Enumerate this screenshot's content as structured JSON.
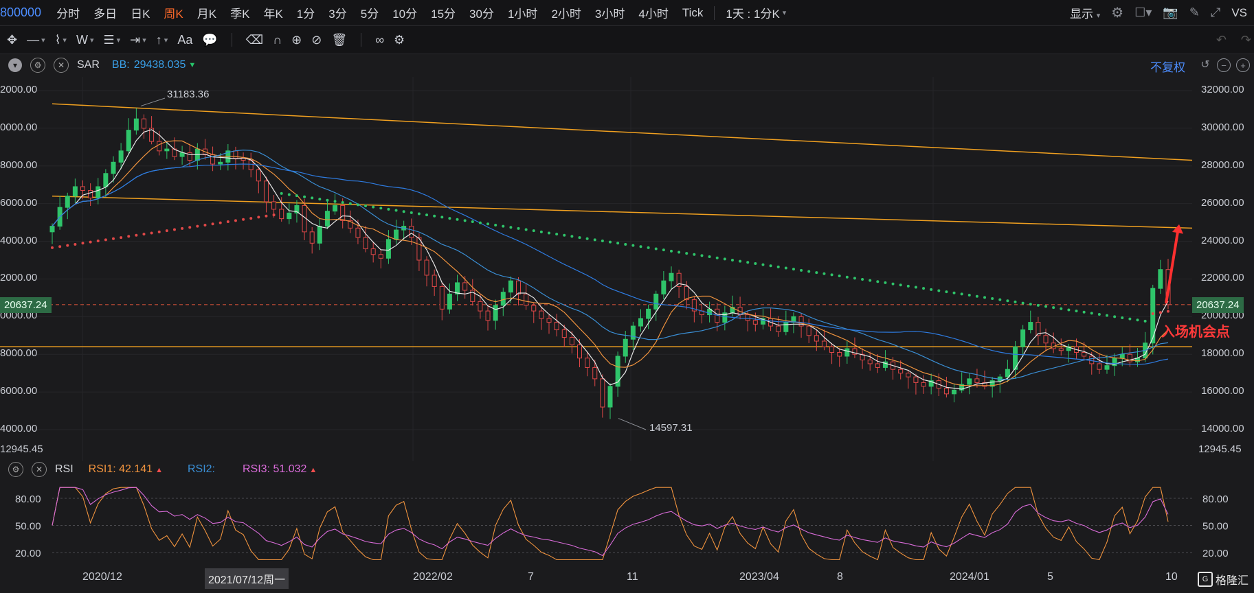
{
  "toolbar": {
    "symbol": "800000",
    "timeframes": [
      "分时",
      "多日",
      "日K",
      "周K",
      "月K",
      "季K",
      "年K",
      "1分",
      "3分",
      "5分",
      "10分",
      "15分",
      "30分",
      "1小时",
      "2小时",
      "3小时",
      "4小时",
      "Tick",
      "1天 : 1分K"
    ],
    "active_timeframe": "周K",
    "display_label": "显示",
    "vs_label": "VS"
  },
  "indicator_bar": {
    "sar_label": "SAR",
    "bb_label": "BB:",
    "bb_value": "29438.035",
    "adjust_label": "不复权"
  },
  "rsi_bar": {
    "name": "RSI",
    "rsi1_label": "RSI1:",
    "rsi1_value": "42.141",
    "rsi2_label": "RSI2:",
    "rsi3_label": "RSI3:",
    "rsi3_value": "51.032"
  },
  "chart_data": {
    "type": "candlestick",
    "y_ticks": [
      14000,
      16000,
      18000,
      20000,
      22000,
      24000,
      26000,
      28000,
      30000,
      32000
    ],
    "y_tick_labels": [
      "14000.00",
      "16000.00",
      "18000.00",
      "20000.00",
      "22000.00",
      "24000.00",
      "26000.00",
      "28000.00",
      "30000.00",
      "32000.00"
    ],
    "ylim": [
      12945.45,
      32000
    ],
    "low_label": "12945.45",
    "current_price": "20637.24",
    "high_annotation": "31183.36",
    "low_annotation": "14597.31",
    "entry_label": "入场机会点",
    "x_labels": [
      "2020/12",
      "2021/07/12周一",
      "2022/02",
      "7",
      "11",
      "2023/04",
      "8",
      "2024/01",
      "5",
      "10"
    ],
    "rsi_ticks": [
      "80.00",
      "50.00",
      "20.00"
    ],
    "trend_lines": [
      {
        "name": "upper-channel",
        "from": 31300,
        "to": 28300
      },
      {
        "name": "lower-channel",
        "from": 26400,
        "to": 24700
      },
      {
        "name": "support",
        "from": 18400,
        "to": 18400
      }
    ],
    "weekly_closes": [
      24800,
      25800,
      26400,
      26900,
      26700,
      26300,
      26900,
      27600,
      28200,
      28800,
      29900,
      30500,
      30000,
      29300,
      28800,
      28900,
      28500,
      28700,
      28300,
      28900,
      28600,
      28100,
      28200,
      28800,
      28400,
      28300,
      27800,
      27200,
      26100,
      25700,
      25200,
      25500,
      25900,
      24500,
      23900,
      24800,
      25600,
      25900,
      25100,
      24700,
      24200,
      23600,
      23300,
      23100,
      24100,
      24600,
      24800,
      24200,
      23000,
      22200,
      21600,
      20400,
      21200,
      21800,
      21400,
      20800,
      20300,
      19800,
      20600,
      21300,
      21900,
      21200,
      20600,
      20300,
      19900,
      19700,
      19300,
      18900,
      18500,
      17800,
      17300,
      16700,
      15200,
      16300,
      17900,
      18800,
      19500,
      19900,
      20400,
      21200,
      21900,
      22300,
      21600,
      20900,
      20300,
      20100,
      20400,
      19700,
      20200,
      20500,
      20100,
      19800,
      19600,
      19900,
      19500,
      19200,
      19700,
      20000,
      19500,
      19000,
      18700,
      18400,
      18100,
      17900,
      18300,
      18000,
      17700,
      17500,
      17300,
      17600,
      17200,
      17000,
      16800,
      16500,
      16300,
      16600,
      16200,
      15900,
      16100,
      16400,
      16700,
      16500,
      16300,
      16600,
      16800,
      17200,
      18400,
      19300,
      19700,
      19000,
      18600,
      18300,
      18200,
      18400,
      18100,
      17900,
      17500,
      17200,
      17400,
      17800,
      18000,
      17600,
      17800,
      18600,
      21500,
      22500,
      20637
    ]
  }
}
